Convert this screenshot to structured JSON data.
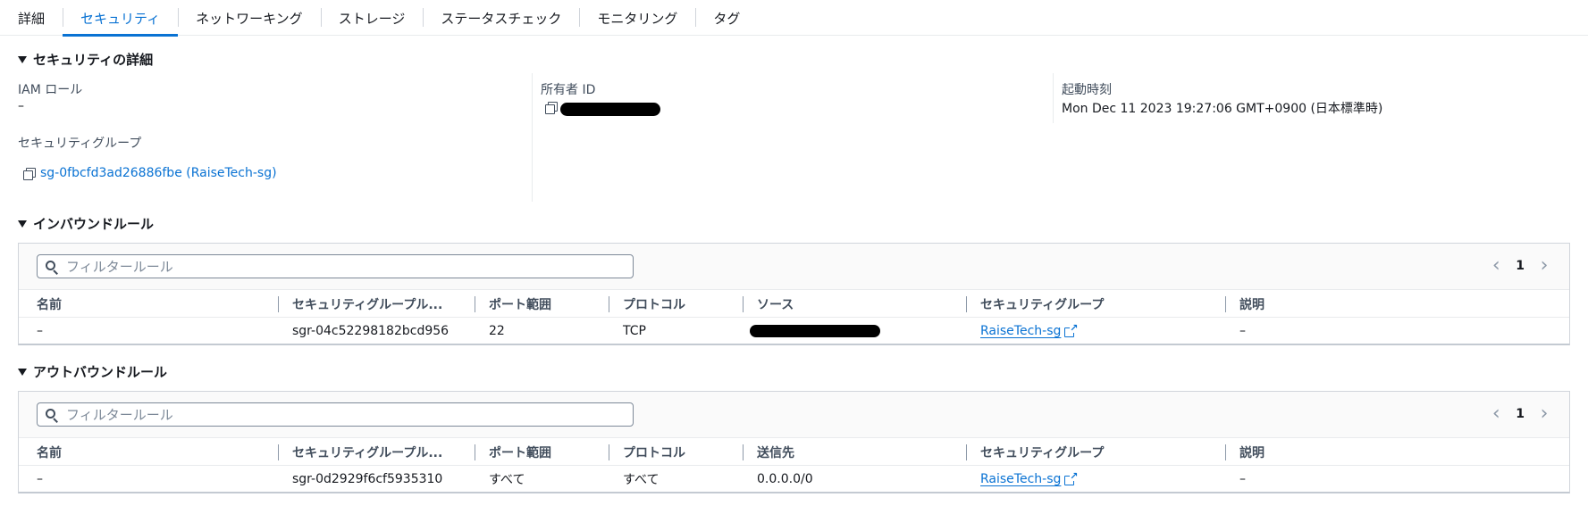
{
  "tabs": [
    {
      "label": "詳細",
      "active": false
    },
    {
      "label": "セキュリティ",
      "active": true
    },
    {
      "label": "ネットワーキング",
      "active": false
    },
    {
      "label": "ストレージ",
      "active": false
    },
    {
      "label": "ステータスチェック",
      "active": false
    },
    {
      "label": "モニタリング",
      "active": false
    },
    {
      "label": "タグ",
      "active": false
    }
  ],
  "security_details": {
    "title": "セキュリティの詳細",
    "iam_role_label": "IAM ロール",
    "iam_role_value": "–",
    "owner_id_label": "所有者 ID",
    "owner_id_redacted": true,
    "launch_time_label": "起動時刻",
    "launch_time_value": "Mon Dec 11 2023 19:27:06 GMT+0900 (日本標準時)",
    "security_group_label": "セキュリティグループ",
    "security_group_link": "sg-0fbcfd3ad26886fbe (RaiseTech-sg)"
  },
  "inbound": {
    "title": "インバウンドルール",
    "filter_placeholder": "フィルタールール",
    "page": "1",
    "columns": [
      "名前",
      "セキュリティグループル...",
      "ポート範囲",
      "プロトコル",
      "ソース",
      "セキュリティグループ",
      "説明"
    ],
    "rows": [
      {
        "name": "–",
        "rule_id": "sgr-04c52298182bcd956",
        "port": "22",
        "protocol": "TCP",
        "source_redacted": true,
        "group": "RaiseTech-sg",
        "description": "–"
      }
    ]
  },
  "outbound": {
    "title": "アウトバウンドルール",
    "filter_placeholder": "フィルタールール",
    "page": "1",
    "columns": [
      "名前",
      "セキュリティグループル...",
      "ポート範囲",
      "プロトコル",
      "送信先",
      "セキュリティグループ",
      "説明"
    ],
    "rows": [
      {
        "name": "–",
        "rule_id": "sgr-0d2929f6cf5935310",
        "port": "すべて",
        "protocol": "すべて",
        "destination": "0.0.0.0/0",
        "group": "RaiseTech-sg",
        "description": "–"
      }
    ]
  },
  "icons": {
    "caret": "caret-down-icon",
    "copy": "copy-icon",
    "search": "search-icon",
    "external": "external-link-icon",
    "prev": "chevron-left-icon",
    "next": "chevron-right-icon"
  },
  "colors": {
    "accent": "#0972d3",
    "text": "#16191f",
    "muted": "#414d5c",
    "border": "#d1d5db"
  }
}
